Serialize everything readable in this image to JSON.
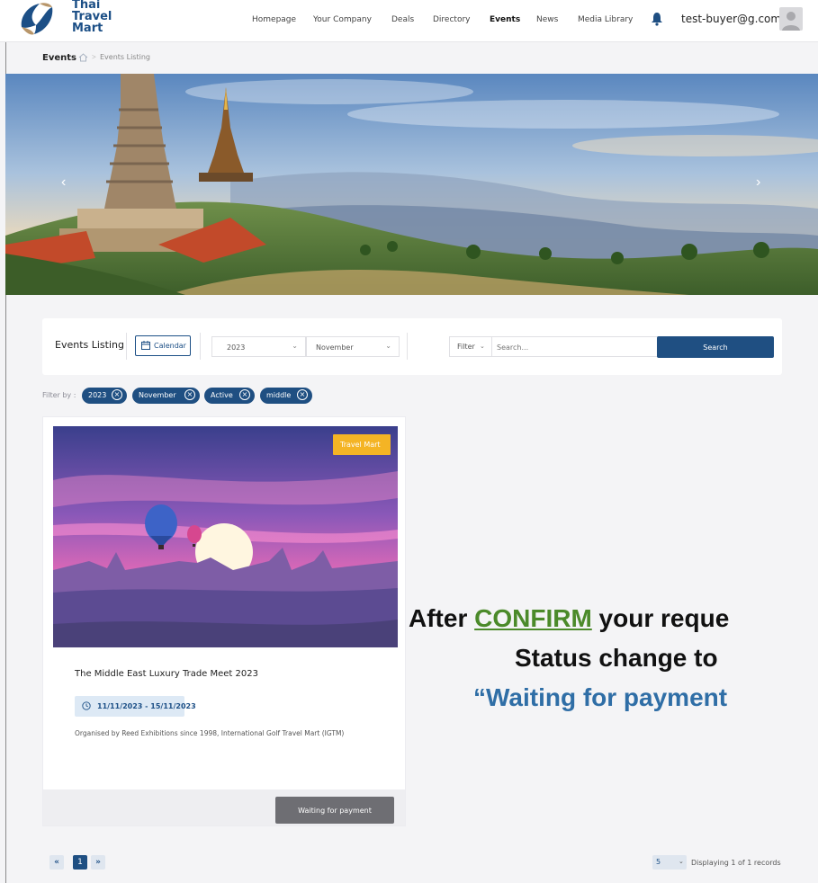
{
  "brand": {
    "logo_lines": [
      "Thai",
      "Travel",
      "Mart"
    ],
    "primary_color": "#1f4f82"
  },
  "nav": {
    "items": [
      {
        "label": "Homepage",
        "active": false
      },
      {
        "label": "Your Company",
        "active": false
      },
      {
        "label": "Deals",
        "active": false
      },
      {
        "label": "Directory",
        "active": false
      },
      {
        "label": "Events",
        "active": true
      },
      {
        "label": "News",
        "active": false
      },
      {
        "label": "Media Library",
        "active": false
      }
    ],
    "user_email": "test-buyer@g.com",
    "notification_icon": "bell-icon",
    "avatar_icon": "user-avatar-icon"
  },
  "breadcrumb": {
    "title": "Events",
    "home_icon": "home-icon",
    "separator": ">",
    "current": "Events Listing"
  },
  "hero": {
    "prev_icon": "chevron-left-icon",
    "next_icon": "chevron-right-icon"
  },
  "filter_bar": {
    "title": "Events Listing",
    "calendar_label": "Calendar",
    "year": "2023",
    "month": "November",
    "filter_label": "Filter",
    "search_placeholder": "Search...",
    "search_button": "Search"
  },
  "active_filters": {
    "label": "Filter by :",
    "chips": [
      "2023",
      "November",
      "Active",
      "middle"
    ]
  },
  "events": [
    {
      "tag": "Travel Mart",
      "title": "The Middle East Luxury Trade Meet 2023",
      "dates": "11/11/2023 - 15/11/2023",
      "organiser": "Organised by Reed Exhibitions since 1998, International Golf Travel Mart (IGTM)",
      "status_button": "Waiting for payment"
    }
  ],
  "annotation": {
    "line1_prefix": "After ",
    "line1_highlight": "CONFIRM",
    "line1_suffix": " your reque",
    "line2": "Status change to",
    "line3": "“Waiting for payment",
    "highlight_color": "#4b8a2a",
    "status_color": "#2f6ea6"
  },
  "pagination": {
    "first": "«",
    "current_page": "1",
    "last": "»",
    "per_page": "5",
    "records_text": "Displaying 1 of 1 records"
  }
}
